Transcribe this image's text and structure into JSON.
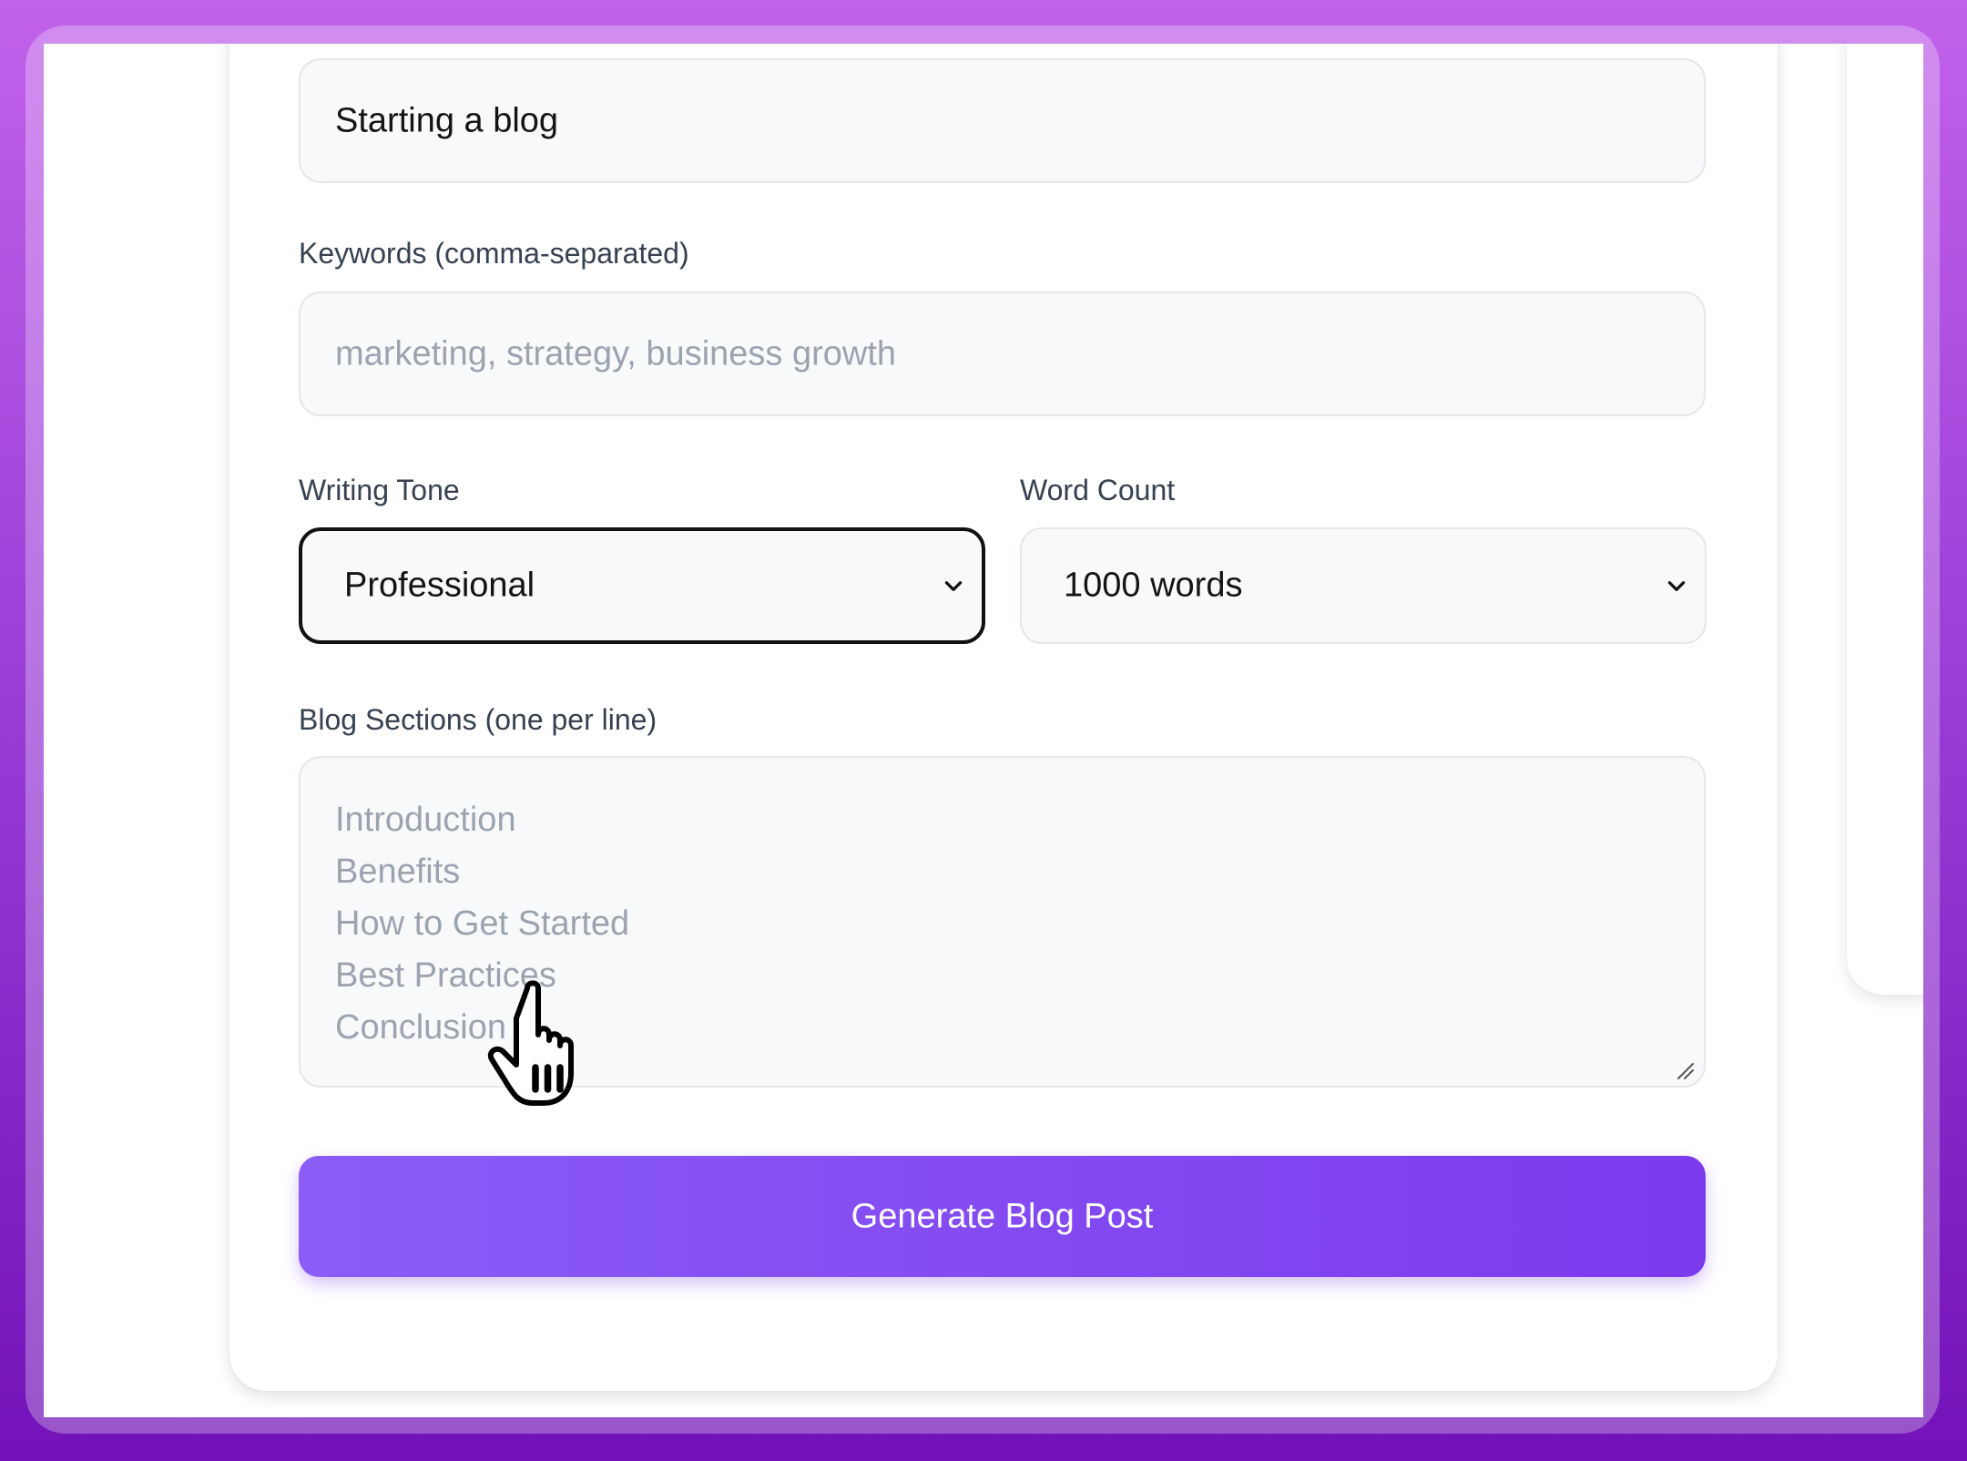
{
  "form": {
    "title_field": {
      "value": "Starting a blog"
    },
    "keywords": {
      "label": "Keywords (comma-separated)",
      "placeholder": "marketing, strategy, business growth"
    },
    "writing_tone": {
      "label": "Writing Tone",
      "selected": "Professional"
    },
    "word_count": {
      "label": "Word Count",
      "selected": "1000 words"
    },
    "sections": {
      "label": "Blog Sections (one per line)",
      "placeholder_lines": [
        "Introduction",
        "Benefits",
        "How to Get Started",
        "Best Practices",
        "Conclusion"
      ]
    },
    "generate_button": {
      "label": "Generate Blog Post"
    }
  },
  "icons": {
    "select_chevron": "chevron-down-icon",
    "textarea_resize": "resize-grip-icon",
    "cursor": "hand-pointer-icon"
  },
  "colors": {
    "background_gradient_top": "#c262ea",
    "background_gradient_bottom": "#7212b8",
    "button_gradient_start": "#8b5cf6",
    "button_gradient_end": "#7c3aed",
    "placeholder": "#9ca3af",
    "label": "#374151"
  }
}
